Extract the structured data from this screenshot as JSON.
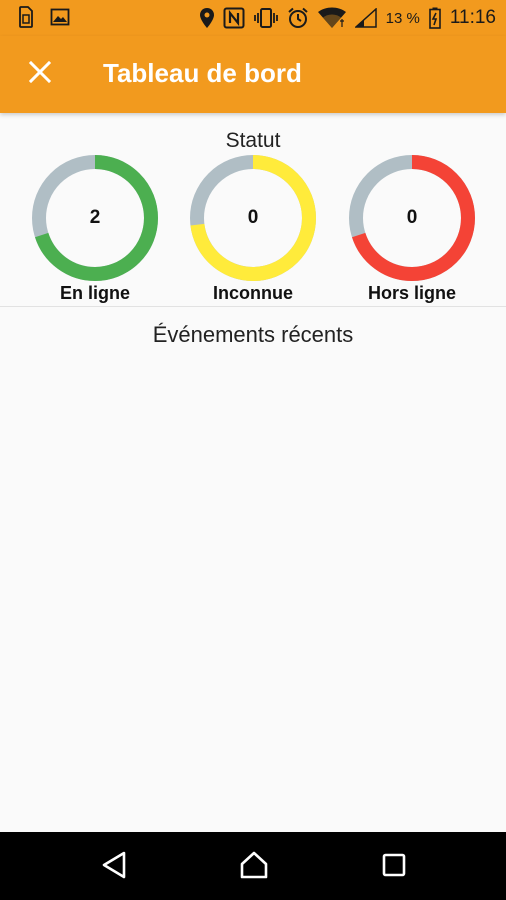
{
  "status_bar": {
    "battery_percent": "13 %",
    "time": "11:16",
    "icons": [
      "sim-card-icon",
      "image-icon",
      "location-pin-icon",
      "nfc-icon",
      "vibrate-icon",
      "alarm-icon",
      "wifi-icon",
      "signal-icon",
      "battery-icon"
    ]
  },
  "app_bar": {
    "title": "Tableau de bord",
    "close_icon": "close-icon",
    "color": "#F29A1E"
  },
  "status_section": {
    "heading": "Statut",
    "gauges": [
      {
        "label": "En ligne",
        "value": "2",
        "color": "#4CAF50",
        "fill_fraction": 0.7
      },
      {
        "label": "Inconnue",
        "value": "0",
        "color": "#FFEB3B",
        "fill_fraction": 0.73
      },
      {
        "label": "Hors ligne",
        "value": "0",
        "color": "#F44336",
        "fill_fraction": 0.7
      }
    ],
    "track_color": "#B0BEC5"
  },
  "events_section": {
    "heading": "Événements récents"
  },
  "nav_bar": {
    "icons": [
      "back-icon",
      "home-icon",
      "recents-icon"
    ]
  }
}
